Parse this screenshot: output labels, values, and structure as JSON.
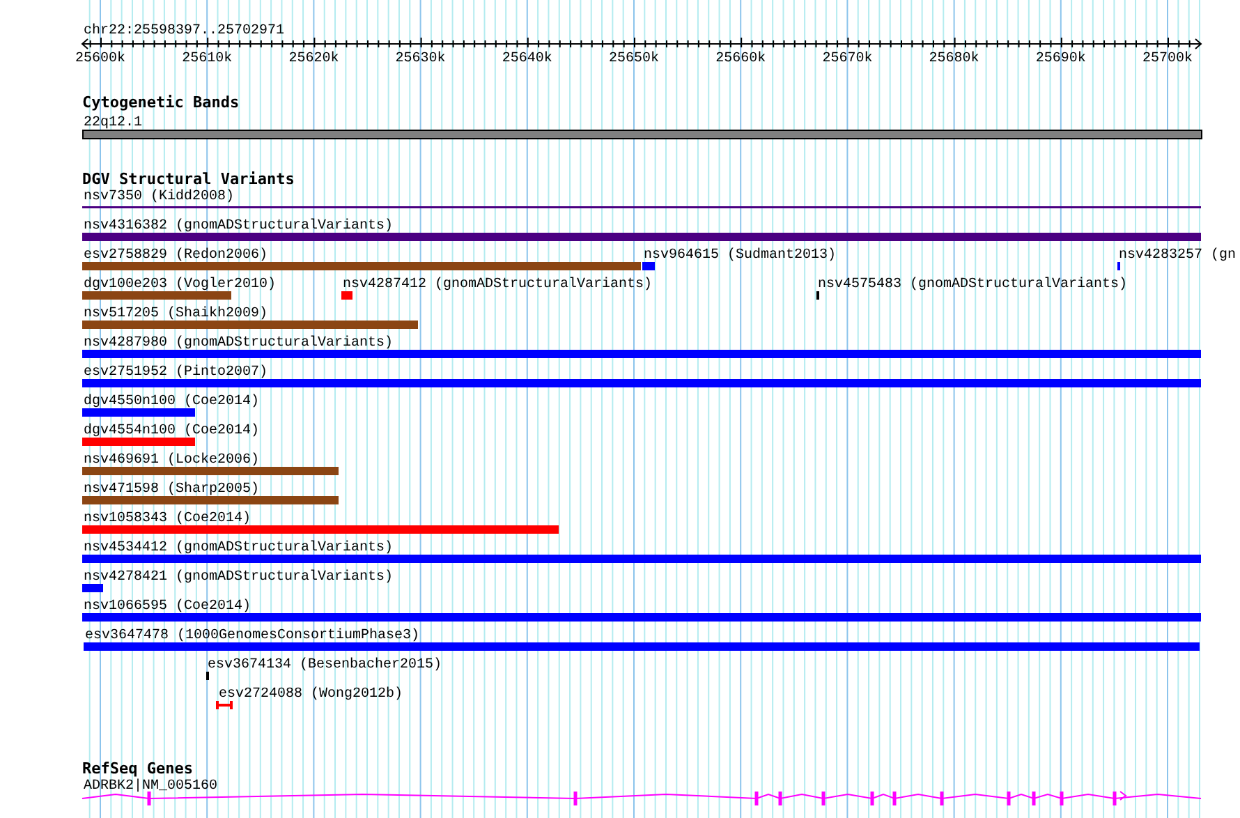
{
  "location": "chr22:25598397..25702971",
  "ruler": {
    "ticks": [
      "25600k",
      "25610k",
      "25620k",
      "25630k",
      "25640k",
      "25650k",
      "25660k",
      "25670k",
      "25680k",
      "25690k",
      "25700k"
    ]
  },
  "tracks": [
    {
      "kind": "bands",
      "title": "Cytogenetic Bands",
      "features": [
        {
          "label": "22q12.1"
        }
      ]
    },
    {
      "kind": "variants",
      "title": "DGV Structural Variants",
      "rows": [
        [
          {
            "label": "nsv7350 (Kidd2008)",
            "kind": "line",
            "color": "#4b0082"
          }
        ],
        [
          {
            "label": "nsv4316382 (gnomADStructuralVariants)",
            "kind": "bar",
            "color": "#4b0082"
          }
        ],
        [
          {
            "label": "esv2758829 (Redon2006)",
            "kind": "bar",
            "color": "#8b4513"
          },
          {
            "label": "nsv964615 (Sudmant2013)",
            "kind": "bar",
            "color": "#0000ff"
          },
          {
            "label": "nsv4283257 (gn",
            "kind": "bar",
            "color": "#0000ff"
          }
        ],
        [
          {
            "label": "dgv100e203 (Vogler2010)",
            "kind": "bar",
            "color": "#8b4513"
          },
          {
            "label": "nsv4287412 (gnomADStructuralVariants)",
            "kind": "bar",
            "color": "#ff0000"
          },
          {
            "label": "nsv4575483 (gnomADStructuralVariants)",
            "kind": "bar",
            "color": "#000000"
          }
        ],
        [
          {
            "label": "nsv517205 (Shaikh2009)",
            "kind": "bar",
            "color": "#8b4513"
          }
        ],
        [
          {
            "label": "nsv4287980 (gnomADStructuralVariants)",
            "kind": "bar",
            "color": "#0000ff"
          }
        ],
        [
          {
            "label": "esv2751952 (Pinto2007)",
            "kind": "bar",
            "color": "#0000ff"
          }
        ],
        [
          {
            "label": "dgv4550n100 (Coe2014)",
            "kind": "bar",
            "color": "#0000ff"
          }
        ],
        [
          {
            "label": "dgv4554n100 (Coe2014)",
            "kind": "bar",
            "color": "#ff0000"
          }
        ],
        [
          {
            "label": "nsv469691 (Locke2006)",
            "kind": "bar",
            "color": "#8b4513"
          }
        ],
        [
          {
            "label": "nsv471598 (Sharp2005)",
            "kind": "bar",
            "color": "#8b4513"
          }
        ],
        [
          {
            "label": "nsv1058343 (Coe2014)",
            "kind": "bar",
            "color": "#ff0000"
          }
        ],
        [
          {
            "label": "nsv4534412 (gnomADStructuralVariants)",
            "kind": "bar",
            "color": "#0000ff"
          }
        ],
        [
          {
            "label": "nsv4278421 (gnomADStructuralVariants)",
            "kind": "bar",
            "color": "#0000ff"
          }
        ],
        [
          {
            "label": "nsv1066595 (Coe2014)",
            "kind": "bar",
            "color": "#0000ff"
          }
        ],
        [
          {
            "label": "esv3647478 (1000GenomesConsortiumPhase3)",
            "kind": "bar",
            "color": "#0000ff"
          }
        ],
        [
          {
            "label": "esv3674134 (Besenbacher2015)",
            "kind": "bar",
            "color": "#000000"
          }
        ],
        [
          {
            "label": "esv2724088 (Wong2012b)",
            "kind": "capped",
            "color": "#ff0000"
          }
        ]
      ]
    },
    {
      "kind": "genes",
      "title": "RefSeq Genes",
      "features": [
        {
          "label": "ADRBK2|NM_005160"
        }
      ]
    }
  ]
}
